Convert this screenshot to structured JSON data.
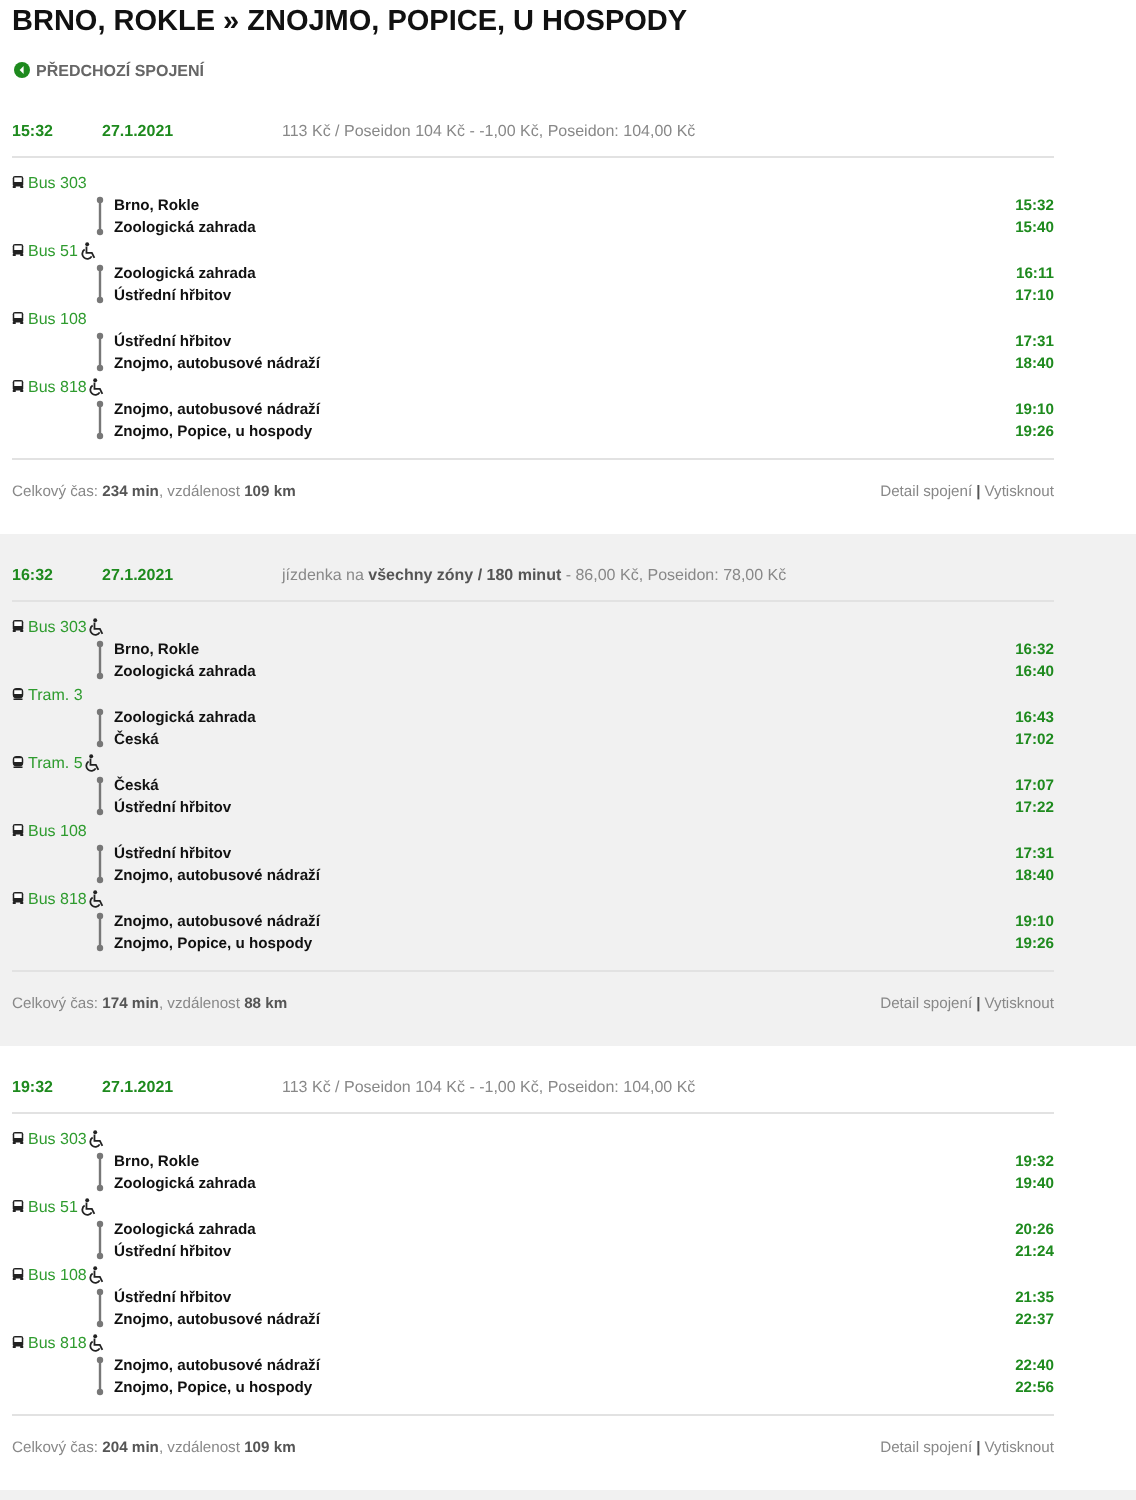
{
  "title": "BRNO, ROKLE » ZNOJMO, POPICE, U HOSPODY",
  "previous_link": "PŘEDCHOZÍ SPOJENÍ",
  "connections": [
    {
      "time": "15:32",
      "date": "27.1.2021",
      "price": "113 Kč / Poseidon 104 Kč - -1,00 Kč, Poseidon: 104,00 Kč",
      "legs": [
        {
          "kind": "bus",
          "line": "Bus 303",
          "accessible": false,
          "stops": [
            {
              "name": "Brno, Rokle",
              "time": "15:32"
            },
            {
              "name": "Zoologická zahrada",
              "time": "15:40"
            }
          ]
        },
        {
          "kind": "bus",
          "line": "Bus 51",
          "accessible": true,
          "stops": [
            {
              "name": "Zoologická zahrada",
              "time": "16:11"
            },
            {
              "name": "Ústřední hřbitov",
              "time": "17:10"
            }
          ]
        },
        {
          "kind": "bus",
          "line": "Bus 108",
          "accessible": false,
          "stops": [
            {
              "name": "Ústřední hřbitov",
              "time": "17:31"
            },
            {
              "name": "Znojmo, autobusové nádraží",
              "time": "18:40"
            }
          ]
        },
        {
          "kind": "bus",
          "line": "Bus 818",
          "accessible": true,
          "stops": [
            {
              "name": "Znojmo, autobusové nádraží",
              "time": "19:10"
            },
            {
              "name": "Znojmo, Popice, u hospody",
              "time": "19:26"
            }
          ]
        }
      ],
      "summary": "Celkový čas: **234 min**, vzdálenost **109 km**",
      "links": [
        "Detail spojení",
        "Vytisknout"
      ],
      "link_separator": "|"
    },
    {
      "time": "16:32",
      "date": "27.1.2021",
      "price": "jízdenka na **všechny zóny / 180 minut** - 86,00 Kč, Poseidon: 78,00 Kč",
      "legs": [
        {
          "kind": "bus",
          "line": "Bus 303",
          "accessible": true,
          "stops": [
            {
              "name": "Brno, Rokle",
              "time": "16:32"
            },
            {
              "name": "Zoologická zahrada",
              "time": "16:40"
            }
          ]
        },
        {
          "kind": "tram",
          "line": "Tram. 3",
          "accessible": false,
          "stops": [
            {
              "name": "Zoologická zahrada",
              "time": "16:43"
            },
            {
              "name": "Česká",
              "time": "17:02"
            }
          ]
        },
        {
          "kind": "tram",
          "line": "Tram. 5",
          "accessible": true,
          "stops": [
            {
              "name": "Česká",
              "time": "17:07"
            },
            {
              "name": "Ústřední hřbitov",
              "time": "17:22"
            }
          ]
        },
        {
          "kind": "bus",
          "line": "Bus 108",
          "accessible": false,
          "stops": [
            {
              "name": "Ústřední hřbitov",
              "time": "17:31"
            },
            {
              "name": "Znojmo, autobusové nádraží",
              "time": "18:40"
            }
          ]
        },
        {
          "kind": "bus",
          "line": "Bus 818",
          "accessible": true,
          "stops": [
            {
              "name": "Znojmo, autobusové nádraží",
              "time": "19:10"
            },
            {
              "name": "Znojmo, Popice, u hospody",
              "time": "19:26"
            }
          ]
        }
      ],
      "summary": "Celkový čas: **174 min**, vzdálenost **88 km**",
      "links": [
        "Detail spojení",
        "Vytisknout"
      ],
      "link_separator": "|"
    },
    {
      "time": "19:32",
      "date": "27.1.2021",
      "price": "113 Kč / Poseidon 104 Kč - -1,00 Kč, Poseidon: 104,00 Kč",
      "legs": [
        {
          "kind": "bus",
          "line": "Bus 303",
          "accessible": true,
          "stops": [
            {
              "name": "Brno, Rokle",
              "time": "19:32"
            },
            {
              "name": "Zoologická zahrada",
              "time": "19:40"
            }
          ]
        },
        {
          "kind": "bus",
          "line": "Bus 51",
          "accessible": true,
          "stops": [
            {
              "name": "Zoologická zahrada",
              "time": "20:26"
            },
            {
              "name": "Ústřední hřbitov",
              "time": "21:24"
            }
          ]
        },
        {
          "kind": "bus",
          "line": "Bus 108",
          "accessible": true,
          "stops": [
            {
              "name": "Ústřední hřbitov",
              "time": "21:35"
            },
            {
              "name": "Znojmo, autobusové nádraží",
              "time": "22:37"
            }
          ]
        },
        {
          "kind": "bus",
          "line": "Bus 818",
          "accessible": true,
          "stops": [
            {
              "name": "Znojmo, autobusové nádraží",
              "time": "22:40"
            },
            {
              "name": "Znojmo, Popice, u hospody",
              "time": "22:56"
            }
          ]
        }
      ],
      "summary": "Celkový čas: **204 min**, vzdálenost **109 km**",
      "links": [
        "Detail spojení",
        "Vytisknout"
      ],
      "link_separator": "|"
    }
  ]
}
